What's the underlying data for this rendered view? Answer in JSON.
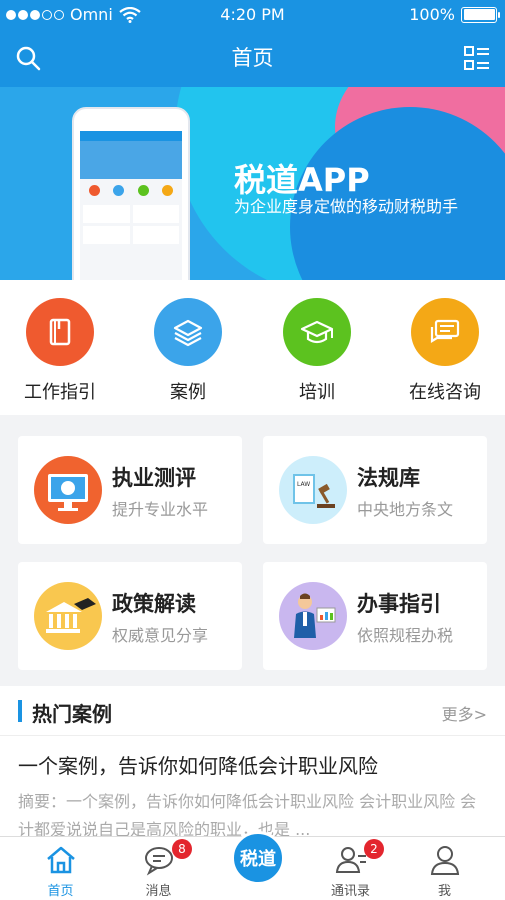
{
  "status": {
    "carrier": "Omni",
    "time": "4:20 PM",
    "battery": "100%"
  },
  "nav": {
    "title": "首页"
  },
  "banner": {
    "title": "税道APP",
    "subtitle": "为企业度身定做的移动财税助手"
  },
  "quick": [
    {
      "label": "工作指引",
      "icon": "book-icon",
      "color": "#ef5a2f"
    },
    {
      "label": "案例",
      "icon": "layers-icon",
      "color": "#3ba4ea"
    },
    {
      "label": "培训",
      "icon": "graduation-cap-icon",
      "color": "#5cc21f"
    },
    {
      "label": "在线咨询",
      "icon": "chat-icon",
      "color": "#f4a816"
    }
  ],
  "cards": [
    {
      "title": "执业测评",
      "subtitle": "提升专业水平"
    },
    {
      "title": "法规库",
      "subtitle": "中央地方条文"
    },
    {
      "title": "政策解读",
      "subtitle": "权威意见分享"
    },
    {
      "title": "办事指引",
      "subtitle": "依照规程办税"
    }
  ],
  "hot": {
    "title": "热门案例",
    "more": "更多>",
    "article_title": "一个案例，告诉你如何降低会计职业风险",
    "article_abstract": "摘要：一个案例，告诉你如何降低会计职业风险 会计职业风险 会计都爱说说自己是高风险的职业，也是 ..."
  },
  "tabs": [
    {
      "label": "首页",
      "active": true
    },
    {
      "label": "消息",
      "badge": "8"
    },
    {
      "label": "税道"
    },
    {
      "label": "通讯录",
      "badge": "2"
    },
    {
      "label": "我"
    }
  ]
}
